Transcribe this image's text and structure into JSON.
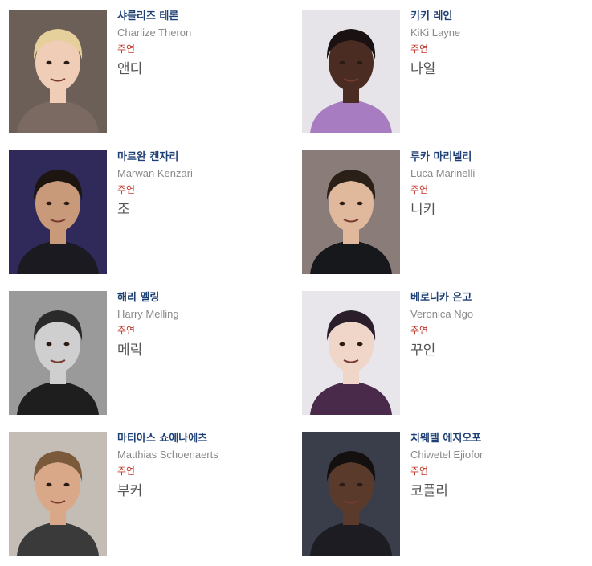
{
  "cast": [
    {
      "korean_name": "샤를리즈 테론",
      "english_name": "Charlize Theron",
      "role_type": "주연",
      "character": "앤디",
      "photo": {
        "bg": "#6b5f58",
        "skin": "#f0cdb6",
        "hair": "#e5cf9a",
        "shirt": "#7a6a62"
      }
    },
    {
      "korean_name": "키키 레인",
      "english_name": "KiKi Layne",
      "role_type": "주연",
      "character": "나일",
      "photo": {
        "bg": "#e6e4e8",
        "skin": "#4a2c22",
        "hair": "#1a1212",
        "shirt": "#a87cc0"
      }
    },
    {
      "korean_name": "마르완 켄자리",
      "english_name": "Marwan Kenzari",
      "role_type": "주연",
      "character": "조",
      "photo": {
        "bg": "#2f2a5a",
        "skin": "#c89a7a",
        "hair": "#1c1510",
        "shirt": "#1a1a20"
      }
    },
    {
      "korean_name": "루카 마리넬리",
      "english_name": "Luca Marinelli",
      "role_type": "주연",
      "character": "니키",
      "photo": {
        "bg": "#8a7c78",
        "skin": "#e0b89c",
        "hair": "#2a2018",
        "shirt": "#16181c"
      }
    },
    {
      "korean_name": "해리 멜링",
      "english_name": "Harry Melling",
      "role_type": "주연",
      "character": "메릭",
      "photo": {
        "bg": "#9a9a9a",
        "skin": "#cfcfcf",
        "hair": "#2a2a2a",
        "shirt": "#1e1e1e"
      }
    },
    {
      "korean_name": "베로니카 은고",
      "english_name": "Veronica Ngo",
      "role_type": "주연",
      "character": "꾸인",
      "photo": {
        "bg": "#e8e6ea",
        "skin": "#efd6c8",
        "hair": "#2a1e2a",
        "shirt": "#4a2a4a"
      }
    },
    {
      "korean_name": "마티아스 쇼에나에츠",
      "english_name": "Matthias Schoenaerts",
      "role_type": "주연",
      "character": "부커",
      "photo": {
        "bg": "#c4bdb6",
        "skin": "#d8a888",
        "hair": "#7a5a3a",
        "shirt": "#3a3a3a"
      }
    },
    {
      "korean_name": "치웨텔 에지오포",
      "english_name": "Chiwetel Ejiofor",
      "role_type": "주연",
      "character": "코플리",
      "photo": {
        "bg": "#3a3e4a",
        "skin": "#5a3a2a",
        "hair": "#141010",
        "shirt": "#1c1c22"
      }
    }
  ]
}
